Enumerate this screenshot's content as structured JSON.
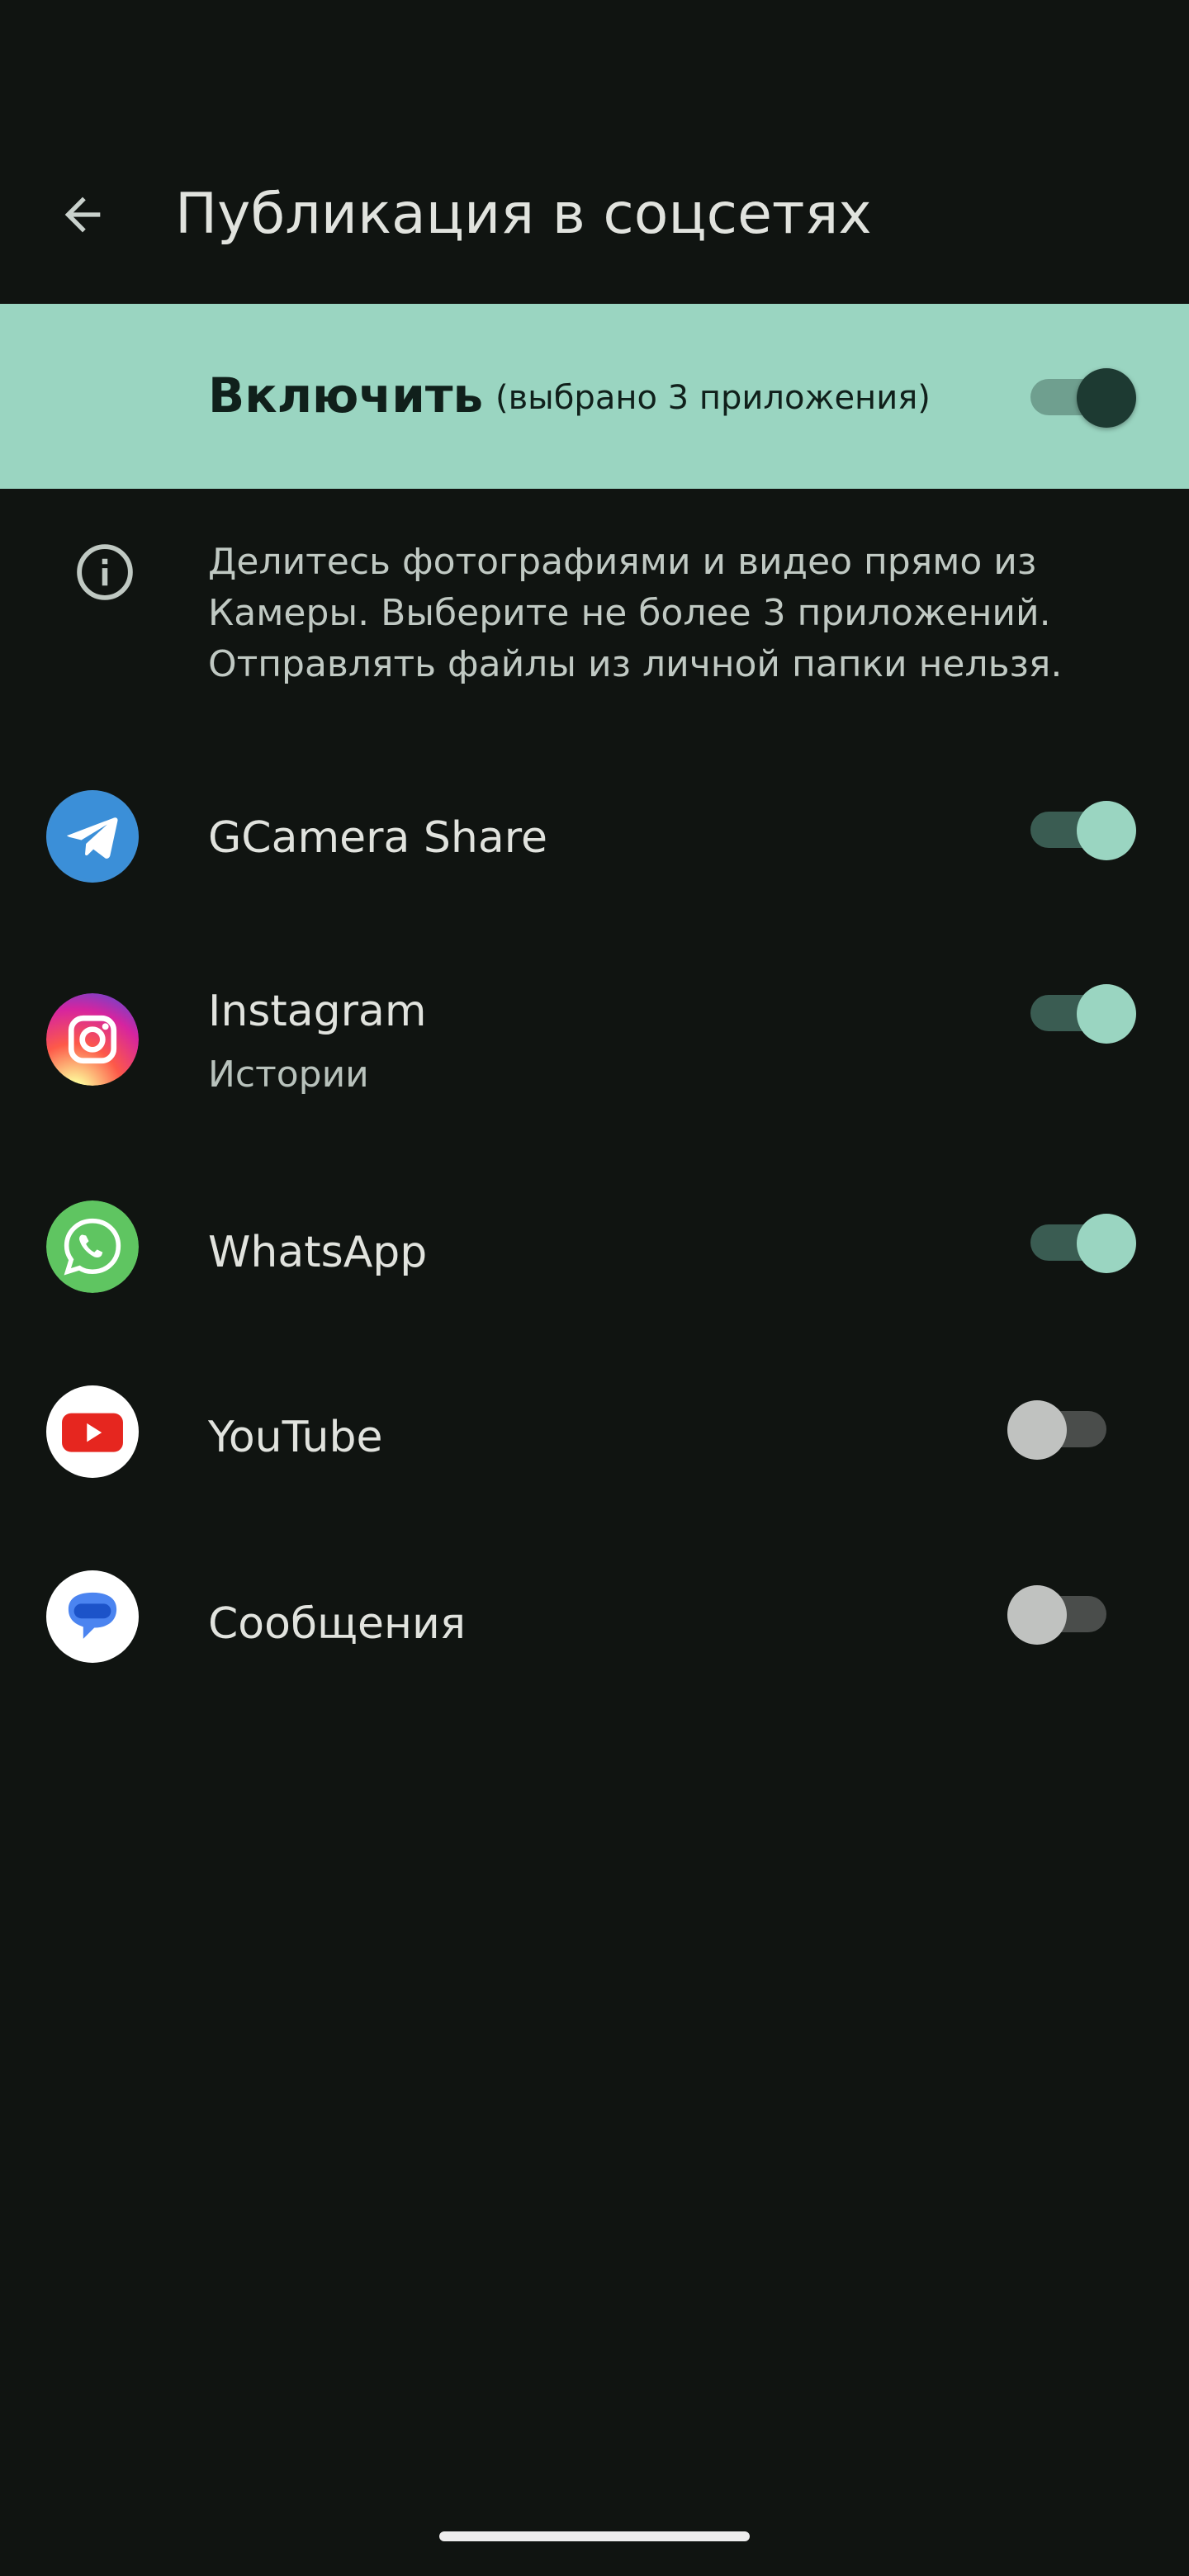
{
  "header": {
    "title": "Публикация в соцсетях",
    "back_icon": "arrow-back-icon"
  },
  "master": {
    "label": "Включить",
    "subtitle": "(выбрано 3 приложения)",
    "enabled": true
  },
  "info": {
    "icon": "info-icon",
    "text": "Делитесь фотографиями и видео прямо из Камеры. Выберите не более 3 приложений. Отправлять файлы из личной папки нельзя."
  },
  "apps": [
    {
      "name": "GCamera Share",
      "subtitle": "",
      "icon": "telegram-icon",
      "enabled": true
    },
    {
      "name": "Instagram",
      "subtitle": "Истории",
      "icon": "instagram-icon",
      "enabled": true
    },
    {
      "name": "WhatsApp",
      "subtitle": "",
      "icon": "whatsapp-icon",
      "enabled": true
    },
    {
      "name": "YouTube",
      "subtitle": "",
      "icon": "youtube-icon",
      "enabled": false
    },
    {
      "name": "Сообщения",
      "subtitle": "",
      "icon": "messages-icon",
      "enabled": false
    }
  ],
  "colors": {
    "background": "#101411",
    "accent": "#9ad5c1",
    "text": "#e1e3de"
  }
}
